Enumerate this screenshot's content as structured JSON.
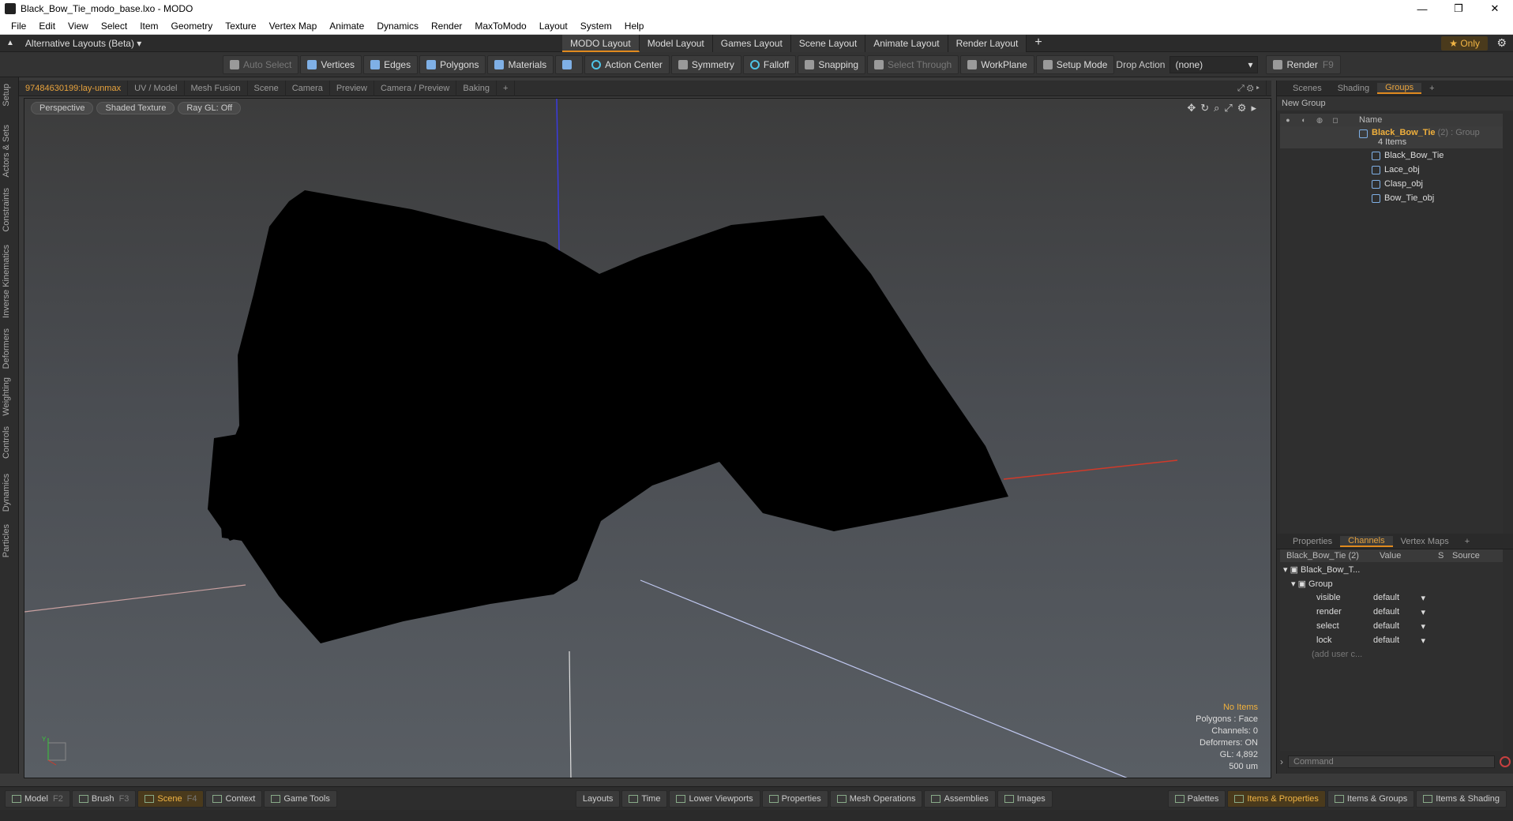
{
  "window": {
    "title": "Black_Bow_Tie_modo_base.lxo - MODO",
    "min": "—",
    "max": "❐",
    "close": "✕"
  },
  "menu": [
    "File",
    "Edit",
    "View",
    "Select",
    "Item",
    "Geometry",
    "Texture",
    "Vertex Map",
    "Animate",
    "Dynamics",
    "Render",
    "MaxToModo",
    "Layout",
    "System",
    "Help"
  ],
  "layout_bar": {
    "alt_layouts": "Alternative Layouts (Beta) ▾",
    "tabs": [
      "MODO Layout",
      "Model Layout",
      "Games Layout",
      "Scene Layout",
      "Animate Layout",
      "Render Layout"
    ],
    "add": "+",
    "only": "★ Only"
  },
  "toolbar": {
    "auto_select": "Auto Select",
    "vertices": "Vertices",
    "edges": "Edges",
    "polygons": "Polygons",
    "materials": "Materials",
    "action_center": "Action Center",
    "symmetry": "Symmetry",
    "falloff": "Falloff",
    "snapping": "Snapping",
    "select_through": "Select Through",
    "workplane": "WorkPlane",
    "setup_mode": "Setup Mode",
    "drop_action_label": "Drop Action",
    "drop_action_value": "(none)",
    "render": "Render",
    "render_key": "F9"
  },
  "left_tabs": [
    "Setup",
    "Actors & Sets",
    "Constraints",
    "Inverse Kinematics",
    "Deformers",
    "Weighting",
    "Controls",
    "Dynamics",
    "Particles"
  ],
  "viewport_tabs": [
    "97484630199:lay-unmax",
    "UV / Model",
    "Mesh Fusion",
    "Scene",
    "Camera",
    "Preview",
    "Camera / Preview",
    "Baking",
    "+"
  ],
  "viewport": {
    "perspective": "Perspective",
    "shading": "Shaded Texture",
    "raygl": "Ray GL: Off",
    "info": {
      "items": "No Items",
      "polygons": "Polygons : Face",
      "channels": "Channels: 0",
      "deformers": "Deformers: ON",
      "gl": "GL: 4,892",
      "scale": "500 um"
    },
    "axis_y": "Y"
  },
  "right_tabs_top": [
    "Scenes",
    "Shading",
    "Groups",
    "+"
  ],
  "groups": {
    "new_group": "New Group",
    "name_header": "Name",
    "group_name": "Black_Bow_Tie",
    "group_suffix": "(2) : Group",
    "item_count": "4 Items",
    "items": [
      "Black_Bow_Tie",
      "Lace_obj",
      "Clasp_obj",
      "Bow_Tie_obj"
    ]
  },
  "right_tabs_bottom": [
    "Properties",
    "Channels",
    "Vertex Maps",
    "+"
  ],
  "channels": {
    "headers": [
      "Black_Bow_Tie (2)",
      "Value",
      "S",
      "Source"
    ],
    "root": "Black_Bow_T...",
    "group": "Group",
    "rows": [
      {
        "name": "visible",
        "value": "default"
      },
      {
        "name": "render",
        "value": "default"
      },
      {
        "name": "select",
        "value": "default"
      },
      {
        "name": "lock",
        "value": "default"
      }
    ],
    "add_user": "(add user c..."
  },
  "command": {
    "placeholder": "Command"
  },
  "bottom_left": [
    {
      "label": "Model",
      "key": "F2"
    },
    {
      "label": "Brush",
      "key": "F3"
    },
    {
      "label": "Scene",
      "key": "F4"
    },
    {
      "label": "Context",
      "key": ""
    },
    {
      "label": "Game Tools",
      "key": ""
    }
  ],
  "bottom_mid": [
    "Layouts",
    "Time",
    "Lower Viewports",
    "Properties",
    "Mesh Operations",
    "Assemblies",
    "Images"
  ],
  "bottom_right": [
    "Palettes",
    "Items & Properties",
    "Items & Groups",
    "Items & Shading"
  ],
  "colors": {
    "accent": "#e08a1e",
    "highlight": "#f0b03c"
  }
}
